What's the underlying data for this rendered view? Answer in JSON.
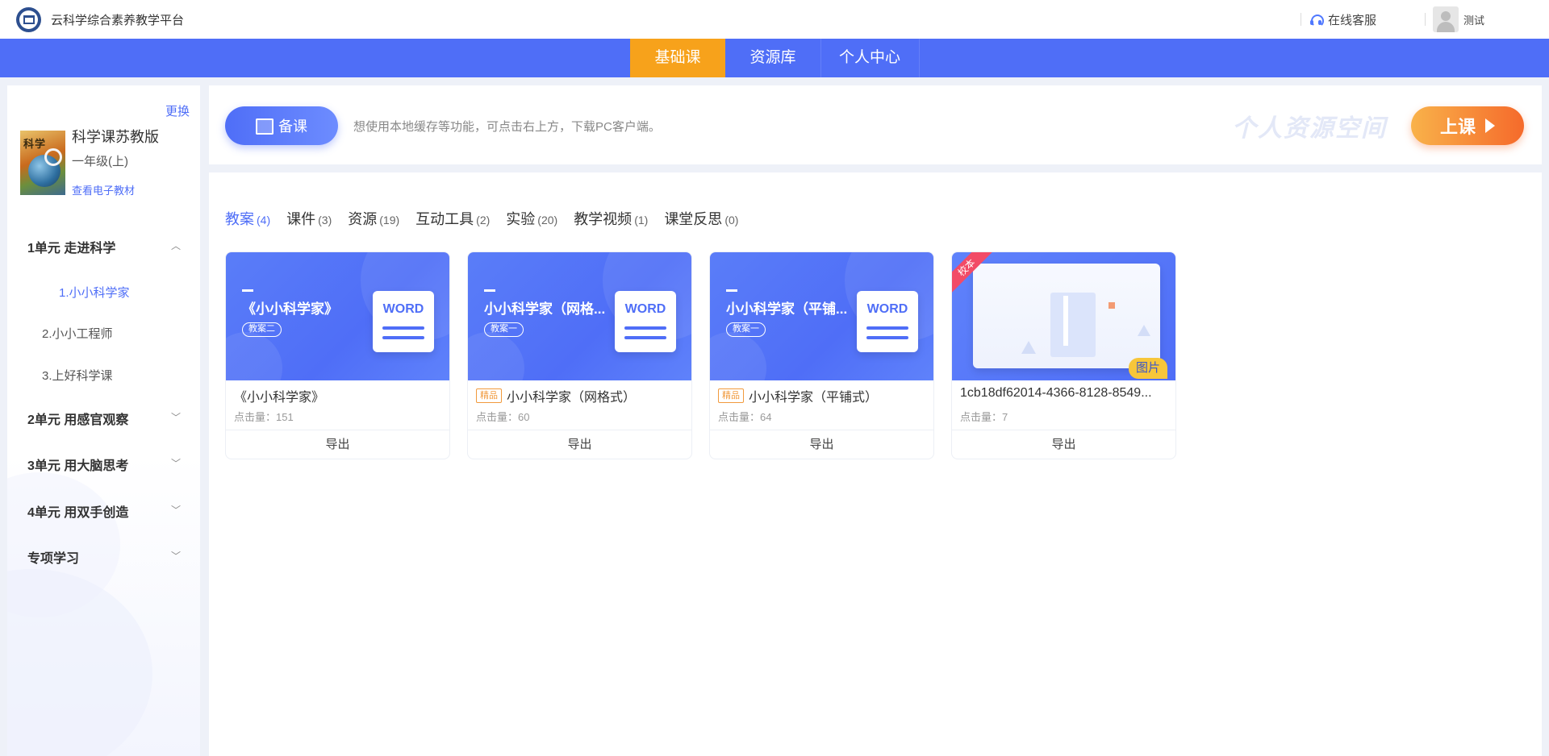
{
  "header": {
    "app_title": "云科学综合素养教学平台",
    "service_label": "在线客服",
    "username": "测试"
  },
  "nav": {
    "tabs": [
      {
        "label": "基础课",
        "active": true
      },
      {
        "label": "资源库",
        "active": false
      },
      {
        "label": "个人中心",
        "active": false
      }
    ]
  },
  "sidebar": {
    "change_label": "更换",
    "book": {
      "cover_text": "科学",
      "name": "科学课苏教版",
      "grade": "一年级(上)",
      "ebook_link": "查看电子教材"
    },
    "units": [
      {
        "label": "1单元 走进科学",
        "expanded": true,
        "lessons": [
          "1.小小科学家",
          "2.小小工程师",
          "3.上好科学课"
        ],
        "active_lesson": 0
      },
      {
        "label": "2单元 用感官观察",
        "expanded": false
      },
      {
        "label": "3单元 用大脑思考",
        "expanded": false
      },
      {
        "label": "4单元 用双手创造",
        "expanded": false
      },
      {
        "label": "专项学习",
        "expanded": false
      }
    ]
  },
  "banner": {
    "prep_button": "备课",
    "tip": "想使用本地缓存等功能，可点击右上方，下载PC客户端。",
    "space_text": "个人资源空间",
    "class_button": "上课"
  },
  "tabs": [
    {
      "label": "教案",
      "count": "(4)",
      "active": true
    },
    {
      "label": "课件",
      "count": "(3)",
      "active": false
    },
    {
      "label": "资源",
      "count": "(19)",
      "active": false
    },
    {
      "label": "互动工具",
      "count": "(2)",
      "active": false
    },
    {
      "label": "实验",
      "count": "(20)",
      "active": false
    },
    {
      "label": "教学视频",
      "count": "(1)",
      "active": false
    },
    {
      "label": "课堂反思",
      "count": "(0)",
      "active": false
    }
  ],
  "cards": [
    {
      "thumb_title": "《小小科学家》",
      "thumb_tag": "教案二",
      "doc_type": "WORD",
      "tag": "",
      "name": "《小小科学家》",
      "clicks": "点击量：151",
      "action": "导出"
    },
    {
      "thumb_title": "小小科学家（网格...",
      "thumb_tag": "教案一",
      "doc_type": "WORD",
      "tag": "精品",
      "name": "小小科学家（网格式）",
      "clicks": "点击量：60",
      "action": "导出"
    },
    {
      "thumb_title": "小小科学家（平铺...",
      "thumb_tag": "教案一",
      "doc_type": "WORD",
      "tag": "精品",
      "name": "小小科学家（平铺式）",
      "clicks": "点击量：64",
      "action": "导出"
    },
    {
      "ribbon": "校本",
      "badge": "图片",
      "name": "1cb18df62014-4366-8128-8549...",
      "clicks": "点击量：7",
      "action": "导出"
    }
  ],
  "colors": {
    "primary": "#4f6ef7",
    "nav_active": "#f7a21b",
    "class_button": "#f56a2b",
    "tag_fine": "#f19a3d",
    "ribbon": "#f24b67",
    "badge": "#f7c63a"
  }
}
